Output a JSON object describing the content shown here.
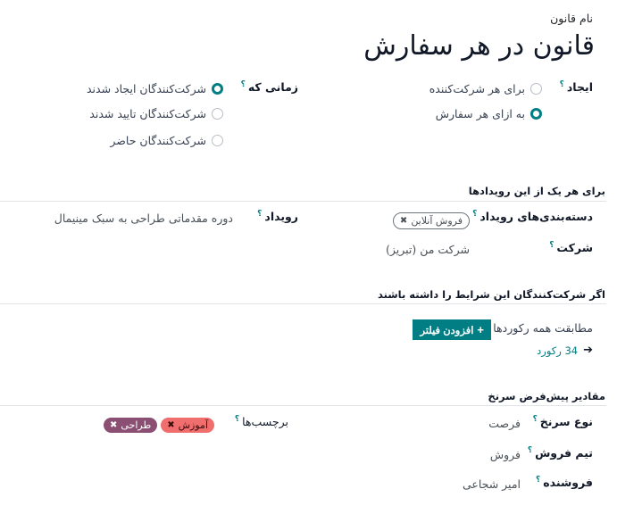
{
  "header": {
    "name_label": "نام قانون",
    "title": "قانون در هر سفارش"
  },
  "create": {
    "label": "ایجاد",
    "help": "؟",
    "options": [
      {
        "label": "برای هر شرکت‌کننده",
        "checked": false
      },
      {
        "label": "به ازای هر سفارش",
        "checked": true
      }
    ]
  },
  "when": {
    "label": "زمانی که",
    "help": "؟",
    "options": [
      {
        "label": "شرکت‌کنندگان ایجاد شدند",
        "checked": true
      },
      {
        "label": "شرکت‌کنندگان تایید شدند",
        "checked": false
      },
      {
        "label": "شرکت‌کنندگان حاضر",
        "checked": false
      }
    ]
  },
  "events_section": {
    "title": "برای هر یک از این رویدادها",
    "event_categories": {
      "label": "دسته‌بندی‌های رویداد",
      "help": "؟",
      "tags": [
        {
          "label": "فروش آنلاین",
          "remove": "✖"
        }
      ]
    },
    "event": {
      "label": "رویداد",
      "help": "؟",
      "value": "دوره مقدماتی طراحی به سبک مینیمال"
    },
    "company": {
      "label": "شرکت",
      "help": "؟",
      "value": "شرکت من (تبریز)"
    }
  },
  "conditions_section": {
    "title": "اگر شرکت‌کنندگان این شرایط را داشته باشند",
    "match_text": "مطابقت همه رکوردها",
    "add_filter": {
      "icon": "+",
      "label": "افزودن فیلتر"
    },
    "records": {
      "arrow": "🡸",
      "label": "34 رکورد"
    }
  },
  "defaults_section": {
    "title": "مقادیر پیش‌فرض سرنخ",
    "lead_type": {
      "label": "نوع سرنخ",
      "help": "؟",
      "value": "فرصت"
    },
    "sales_team": {
      "label": "تیم فروش",
      "help": "؟",
      "value": "فروش"
    },
    "salesperson": {
      "label": "فروشنده",
      "help": "؟",
      "value": "امیر شجاعی"
    },
    "tags": {
      "label": "برچسب‌ها",
      "help": "؟",
      "items": [
        {
          "label": "آموزش",
          "remove": "✖",
          "color": "#f06e6e"
        },
        {
          "label": "طراحی",
          "remove": "✖",
          "color": "#8a4f72"
        }
      ]
    }
  },
  "colors": {
    "primary": "#017e84",
    "separator": "#e2e4e7"
  }
}
